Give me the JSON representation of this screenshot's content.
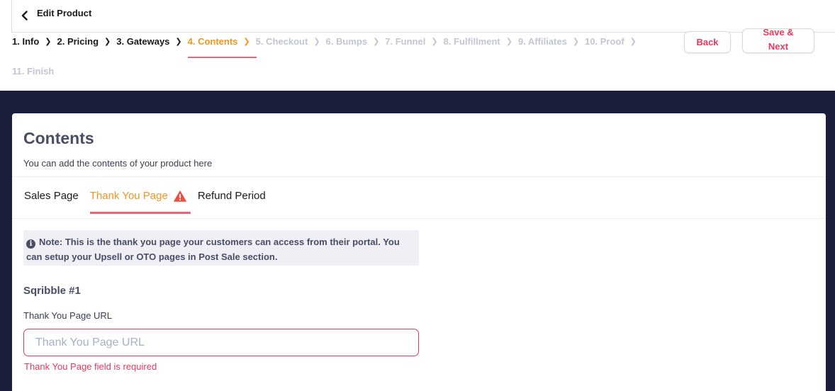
{
  "header": {
    "title": "Edit Product",
    "back_icon": "chevron-left-icon"
  },
  "steps": [
    {
      "label": "1. Info",
      "state": "done"
    },
    {
      "label": "2. Pricing",
      "state": "done"
    },
    {
      "label": "3. Gateways",
      "state": "done"
    },
    {
      "label": "4. Contents",
      "state": "active"
    },
    {
      "label": "5. Checkout",
      "state": "todo"
    },
    {
      "label": "6. Bumps",
      "state": "todo"
    },
    {
      "label": "7. Funnel",
      "state": "todo"
    },
    {
      "label": "8. Fulfillment",
      "state": "todo"
    },
    {
      "label": "9. Affiliates",
      "state": "todo"
    },
    {
      "label": "10. Proof",
      "state": "todo"
    },
    {
      "label": "11. Finish",
      "state": "todo"
    }
  ],
  "step_separator": "❯",
  "actions": {
    "back_label": "Back",
    "save_next_label": "Save & Next"
  },
  "card": {
    "heading": "Contents",
    "subtitle": "You can add the contents of your product here",
    "tabs": [
      {
        "label": "Sales Page",
        "active": false
      },
      {
        "label": "Thank You Page",
        "active": true,
        "warning": true
      },
      {
        "label": "Refund Period",
        "active": false
      }
    ],
    "note": {
      "icon": "info-icon",
      "text": "Note: This is the thank you page your customers can access from their portal. You can setup your Upsell or OTO pages in Post Sale section."
    },
    "section_title": "Sqribble #1",
    "field": {
      "label": "Thank You Page URL",
      "value": "",
      "placeholder": "Thank You Page URL",
      "error": "Thank You Page field is required"
    }
  },
  "colors": {
    "accent_orange": "#f7941d",
    "accent_pink": "#f0627a",
    "error_red": "#e8395b",
    "dark_background": "#1b1f3b",
    "warning_red": "#f04e3e"
  }
}
